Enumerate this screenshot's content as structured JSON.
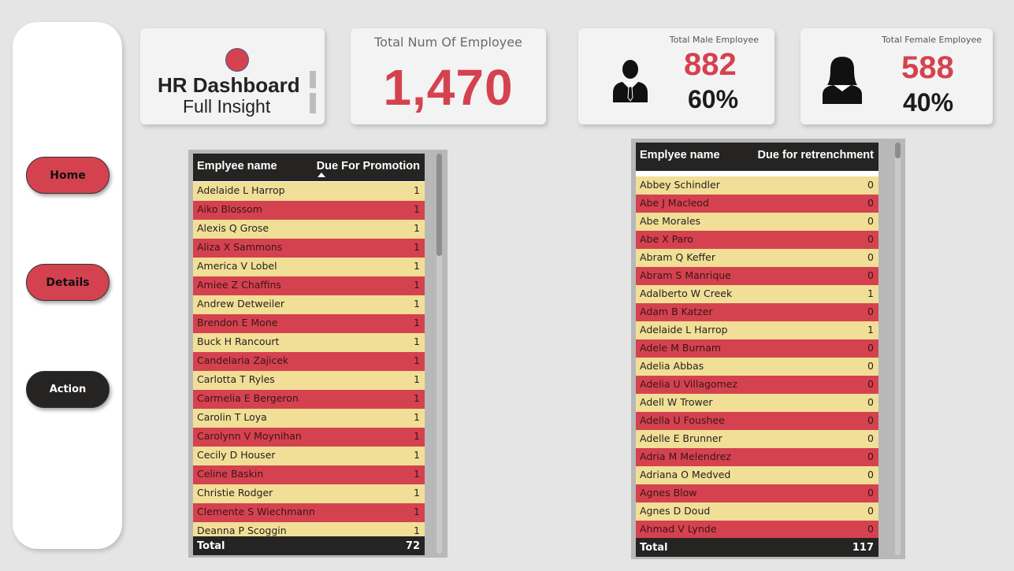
{
  "nav": {
    "home_label": "Home",
    "details_label": "Details",
    "action_label": "Action"
  },
  "header": {
    "title": "HR Dashboard",
    "subtitle": "Full Insight"
  },
  "kpis": {
    "total_label": "Total Num Of Employee",
    "total_value": "1,470",
    "male_label": "Total Male Employee",
    "male_value": "882",
    "male_pct": "60%",
    "female_label": "Total Female Employee",
    "female_value": "588",
    "female_pct": "40%"
  },
  "promotion_table": {
    "col_name": "Emplyee name",
    "col_value": "Due For Promotion",
    "rows": [
      {
        "name": "Adelaide L Harrop",
        "value": "1"
      },
      {
        "name": "Aiko Blossom",
        "value": "1"
      },
      {
        "name": "Alexis Q Grose",
        "value": "1"
      },
      {
        "name": "Aliza X Sammons",
        "value": "1"
      },
      {
        "name": "America V Lobel",
        "value": "1"
      },
      {
        "name": "Amiee Z Chaffins",
        "value": "1"
      },
      {
        "name": "Andrew Detweiler",
        "value": "1"
      },
      {
        "name": "Brendon E Mone",
        "value": "1"
      },
      {
        "name": "Buck H Rancourt",
        "value": "1"
      },
      {
        "name": "Candelaria Zajicek",
        "value": "1"
      },
      {
        "name": "Carlotta T Ryles",
        "value": "1"
      },
      {
        "name": "Carmelia E Bergeron",
        "value": "1"
      },
      {
        "name": "Carolin T Loya",
        "value": "1"
      },
      {
        "name": "Carolynn V Moynihan",
        "value": "1"
      },
      {
        "name": "Cecily D Houser",
        "value": "1"
      },
      {
        "name": "Celine Baskin",
        "value": "1"
      },
      {
        "name": "Christie Rodger",
        "value": "1"
      },
      {
        "name": "Clemente S Wiechmann",
        "value": "1"
      },
      {
        "name": "Deanna P Scoggin",
        "value": "1"
      }
    ],
    "total_label": "Total",
    "total_value": "72"
  },
  "retrenchment_table": {
    "col_name": "Emplyee name",
    "col_value": "Due for retrenchment",
    "rows": [
      {
        "name": "Abbey Schindler",
        "value": "0"
      },
      {
        "name": "Abe J Macleod",
        "value": "0"
      },
      {
        "name": "Abe Morales",
        "value": "0"
      },
      {
        "name": "Abe X Paro",
        "value": "0"
      },
      {
        "name": "Abram Q Keffer",
        "value": "0"
      },
      {
        "name": "Abram S Manrique",
        "value": "0"
      },
      {
        "name": "Adalberto W Creek",
        "value": "1"
      },
      {
        "name": "Adam B Katzer",
        "value": "0"
      },
      {
        "name": "Adelaide L Harrop",
        "value": "1"
      },
      {
        "name": "Adele M Burnam",
        "value": "0"
      },
      {
        "name": "Adelia Abbas",
        "value": "0"
      },
      {
        "name": "Adelia U Villagomez",
        "value": "0"
      },
      {
        "name": "Adell W Trower",
        "value": "0"
      },
      {
        "name": "Adella U Foushee",
        "value": "0"
      },
      {
        "name": "Adelle E Brunner",
        "value": "0"
      },
      {
        "name": "Adria M Melendrez",
        "value": "0"
      },
      {
        "name": "Adriana O Medved",
        "value": "0"
      },
      {
        "name": "Agnes Blow",
        "value": "0"
      },
      {
        "name": "Agnes D Doud",
        "value": "0"
      },
      {
        "name": "Ahmad V Lynde",
        "value": "0"
      }
    ],
    "total_label": "Total",
    "total_value": "117"
  },
  "colors": {
    "accent_red": "#d5424f",
    "row_yellow": "#f2df97",
    "header_dark": "#252423"
  }
}
